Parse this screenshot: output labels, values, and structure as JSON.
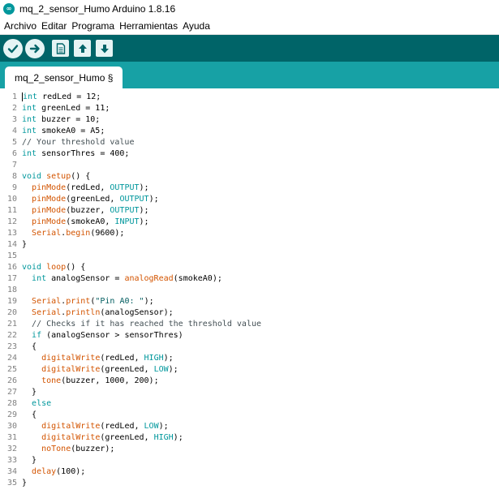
{
  "window": {
    "title": "mq_2_sensor_Humo Arduino 1.8.16",
    "icon": "arduino-icon"
  },
  "menu": {
    "items": [
      "Archivo",
      "Editar",
      "Programa",
      "Herramientas",
      "Ayuda"
    ]
  },
  "toolbar": {
    "buttons": [
      {
        "name": "verify-icon",
        "glyph": "✔"
      },
      {
        "name": "upload-icon",
        "glyph": "➜"
      },
      {
        "name": "new-sketch-icon",
        "glyph": "new"
      },
      {
        "name": "open-sketch-icon",
        "glyph": "up"
      },
      {
        "name": "save-sketch-icon",
        "glyph": "down"
      }
    ]
  },
  "tab": {
    "label": "mq_2_sensor_Humo §"
  },
  "colors": {
    "keyword": "#00979c",
    "function": "#d35400",
    "comment": "#434f54",
    "string": "#005c5f",
    "toolbar_bg": "#006468",
    "tabbar_bg": "#17a1a5"
  },
  "code_lines": [
    [
      [
        "kw",
        "int"
      ],
      [
        "p",
        " redLed = 12;"
      ]
    ],
    [
      [
        "kw",
        "int"
      ],
      [
        "p",
        " greenLed = 11;"
      ]
    ],
    [
      [
        "kw",
        "int"
      ],
      [
        "p",
        " buzzer = 10;"
      ]
    ],
    [
      [
        "kw",
        "int"
      ],
      [
        "p",
        " smokeA0 = A5;"
      ]
    ],
    [
      [
        "cm",
        "// Your threshold value"
      ]
    ],
    [
      [
        "kw",
        "int"
      ],
      [
        "p",
        " sensorThres = 400;"
      ]
    ],
    [],
    [
      [
        "kw",
        "void"
      ],
      [
        "p",
        " "
      ],
      [
        "fn",
        "setup"
      ],
      [
        "p",
        "() {"
      ]
    ],
    [
      [
        "p",
        "  "
      ],
      [
        "fn",
        "pinMode"
      ],
      [
        "p",
        "(redLed, "
      ],
      [
        "c",
        "OUTPUT"
      ],
      [
        "p",
        ");"
      ]
    ],
    [
      [
        "p",
        "  "
      ],
      [
        "fn",
        "pinMode"
      ],
      [
        "p",
        "(greenLed, "
      ],
      [
        "c",
        "OUTPUT"
      ],
      [
        "p",
        ");"
      ]
    ],
    [
      [
        "p",
        "  "
      ],
      [
        "fn",
        "pinMode"
      ],
      [
        "p",
        "(buzzer, "
      ],
      [
        "c",
        "OUTPUT"
      ],
      [
        "p",
        ");"
      ]
    ],
    [
      [
        "p",
        "  "
      ],
      [
        "fn",
        "pinMode"
      ],
      [
        "p",
        "(smokeA0, "
      ],
      [
        "c",
        "INPUT"
      ],
      [
        "p",
        ");"
      ]
    ],
    [
      [
        "p",
        "  "
      ],
      [
        "fn",
        "Serial"
      ],
      [
        "p",
        "."
      ],
      [
        "fn",
        "begin"
      ],
      [
        "p",
        "(9600);"
      ]
    ],
    [
      [
        "p",
        "}"
      ]
    ],
    [],
    [
      [
        "kw",
        "void"
      ],
      [
        "p",
        " "
      ],
      [
        "fn",
        "loop"
      ],
      [
        "p",
        "() {"
      ]
    ],
    [
      [
        "p",
        "  "
      ],
      [
        "kw",
        "int"
      ],
      [
        "p",
        " analogSensor = "
      ],
      [
        "fn",
        "analogRead"
      ],
      [
        "p",
        "(smokeA0);"
      ]
    ],
    [],
    [
      [
        "p",
        "  "
      ],
      [
        "fn",
        "Serial"
      ],
      [
        "p",
        "."
      ],
      [
        "fn",
        "print"
      ],
      [
        "p",
        "("
      ],
      [
        "s",
        "\"Pin A0: \""
      ],
      [
        "p",
        ");"
      ]
    ],
    [
      [
        "p",
        "  "
      ],
      [
        "fn",
        "Serial"
      ],
      [
        "p",
        "."
      ],
      [
        "fn",
        "println"
      ],
      [
        "p",
        "(analogSensor);"
      ]
    ],
    [
      [
        "p",
        "  "
      ],
      [
        "cm",
        "// Checks if it has reached the threshold value"
      ]
    ],
    [
      [
        "p",
        "  "
      ],
      [
        "kw",
        "if"
      ],
      [
        "p",
        " (analogSensor > sensorThres)"
      ]
    ],
    [
      [
        "p",
        "  {"
      ]
    ],
    [
      [
        "p",
        "    "
      ],
      [
        "fn",
        "digitalWrite"
      ],
      [
        "p",
        "(redLed, "
      ],
      [
        "c",
        "HIGH"
      ],
      [
        "p",
        ");"
      ]
    ],
    [
      [
        "p",
        "    "
      ],
      [
        "fn",
        "digitalWrite"
      ],
      [
        "p",
        "(greenLed, "
      ],
      [
        "c",
        "LOW"
      ],
      [
        "p",
        ");"
      ]
    ],
    [
      [
        "p",
        "    "
      ],
      [
        "fn",
        "tone"
      ],
      [
        "p",
        "(buzzer, 1000, 200);"
      ]
    ],
    [
      [
        "p",
        "  }"
      ]
    ],
    [
      [
        "p",
        "  "
      ],
      [
        "kw",
        "else"
      ]
    ],
    [
      [
        "p",
        "  {"
      ]
    ],
    [
      [
        "p",
        "    "
      ],
      [
        "fn",
        "digitalWrite"
      ],
      [
        "p",
        "(redLed, "
      ],
      [
        "c",
        "LOW"
      ],
      [
        "p",
        ");"
      ]
    ],
    [
      [
        "p",
        "    "
      ],
      [
        "fn",
        "digitalWrite"
      ],
      [
        "p",
        "(greenLed, "
      ],
      [
        "c",
        "HIGH"
      ],
      [
        "p",
        ");"
      ]
    ],
    [
      [
        "p",
        "    "
      ],
      [
        "fn",
        "noTone"
      ],
      [
        "p",
        "(buzzer);"
      ]
    ],
    [
      [
        "p",
        "  }"
      ]
    ],
    [
      [
        "p",
        "  "
      ],
      [
        "fn",
        "delay"
      ],
      [
        "p",
        "(100);"
      ]
    ],
    [
      [
        "p",
        "}"
      ]
    ]
  ]
}
